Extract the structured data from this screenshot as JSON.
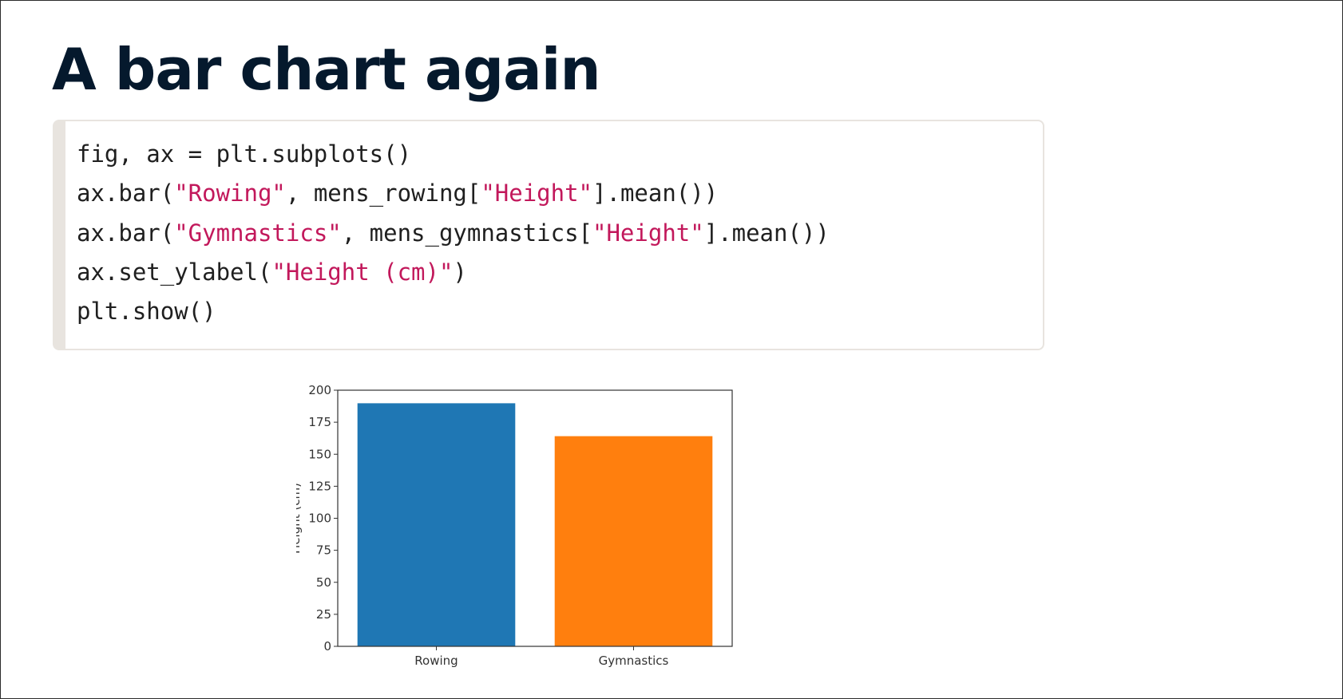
{
  "slide": {
    "title": "A bar chart again"
  },
  "code": {
    "lines": [
      [
        {
          "t": "fig, ax = plt.subplots()",
          "s": false
        }
      ],
      [
        {
          "t": "ax.bar(",
          "s": false
        },
        {
          "t": "\"Rowing\"",
          "s": true
        },
        {
          "t": ", mens_rowing[",
          "s": false
        },
        {
          "t": "\"Height\"",
          "s": true
        },
        {
          "t": "].mean())",
          "s": false
        }
      ],
      [
        {
          "t": "ax.bar(",
          "s": false
        },
        {
          "t": "\"Gymnastics\"",
          "s": true
        },
        {
          "t": ", mens_gymnastics[",
          "s": false
        },
        {
          "t": "\"Height\"",
          "s": true
        },
        {
          "t": "].mean())",
          "s": false
        }
      ],
      [
        {
          "t": "ax.set_ylabel(",
          "s": false
        },
        {
          "t": "\"Height (cm)\"",
          "s": true
        },
        {
          "t": ")",
          "s": false
        }
      ],
      [
        {
          "t": "plt.show()",
          "s": false
        }
      ]
    ]
  },
  "colors": {
    "title": "#05192d",
    "code_text": "#1f1f1f",
    "code_string": "#c2185b",
    "code_border": "#e8e4df"
  },
  "chart_data": {
    "type": "bar",
    "categories": [
      "Rowing",
      "Gymnastics"
    ],
    "values": [
      189.8,
      164.1
    ],
    "colors": [
      "#1f77b4",
      "#ff7f0e"
    ],
    "title": "",
    "xlabel": "",
    "ylabel": "Height (cm)",
    "ylim": [
      0,
      200
    ],
    "yticks": [
      0,
      25,
      50,
      75,
      100,
      125,
      150,
      175,
      200
    ],
    "grid": false,
    "legend": "none"
  }
}
